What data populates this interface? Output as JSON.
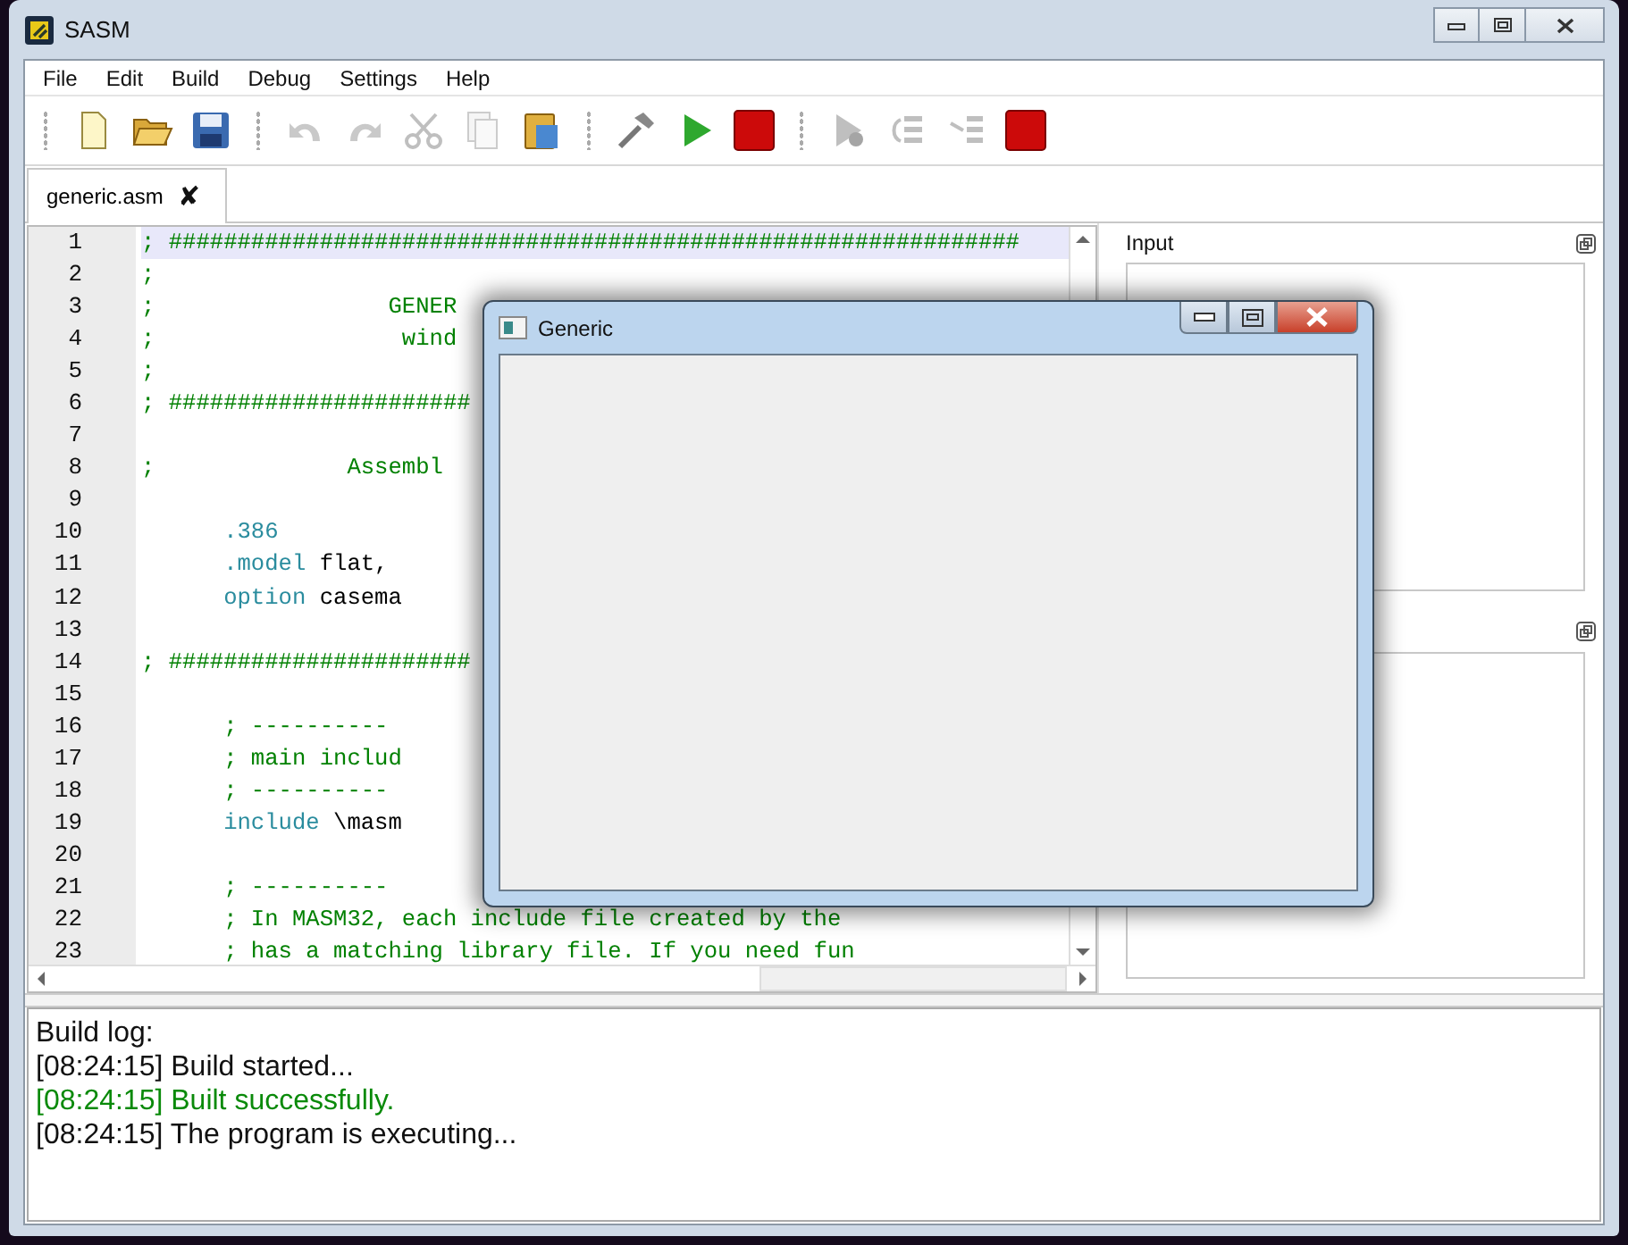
{
  "window": {
    "title": "SASM"
  },
  "menu": [
    "File",
    "Edit",
    "Build",
    "Debug",
    "Settings",
    "Help"
  ],
  "toolbar": [
    [
      {
        "kind": "new",
        "disabled": false
      },
      {
        "kind": "open",
        "disabled": false
      },
      {
        "kind": "save",
        "disabled": false
      }
    ],
    [
      {
        "kind": "undo",
        "disabled": true
      },
      {
        "kind": "redo",
        "disabled": true
      },
      {
        "kind": "cut",
        "disabled": true
      },
      {
        "kind": "copy",
        "disabled": true
      },
      {
        "kind": "paste",
        "disabled": false
      }
    ],
    [
      {
        "kind": "build",
        "disabled": false
      },
      {
        "kind": "run",
        "disabled": false
      },
      {
        "kind": "stop",
        "disabled": false
      }
    ],
    [
      {
        "kind": "debug",
        "disabled": true
      },
      {
        "kind": "step-over",
        "disabled": true
      },
      {
        "kind": "step-into",
        "disabled": true
      },
      {
        "kind": "stop",
        "disabled": false
      }
    ]
  ],
  "tabs": [
    {
      "label": "generic.asm",
      "close": "✘",
      "selected": true
    }
  ],
  "editor": {
    "lines": [
      {
        "number": "1",
        "highlighted": true,
        "segments": [
          {
            "kind": "comment",
            "text": "; ##############################################################"
          }
        ]
      },
      {
        "number": "2",
        "highlighted": false,
        "segments": [
          {
            "kind": "comment",
            "text": ";"
          }
        ]
      },
      {
        "number": "3",
        "highlighted": false,
        "segments": [
          {
            "kind": "comment",
            "text": ";                 GENER"
          }
        ]
      },
      {
        "number": "4",
        "highlighted": false,
        "segments": [
          {
            "kind": "comment",
            "text": ";                  wind"
          }
        ]
      },
      {
        "number": "5",
        "highlighted": false,
        "segments": [
          {
            "kind": "comment",
            "text": ";"
          }
        ]
      },
      {
        "number": "6",
        "highlighted": false,
        "segments": [
          {
            "kind": "comment",
            "text": "; ######################"
          }
        ]
      },
      {
        "number": "7",
        "highlighted": false
      },
      {
        "number": "8",
        "highlighted": false,
        "segments": [
          {
            "kind": "comment",
            "text": ";              Assembl"
          }
        ]
      },
      {
        "number": "9",
        "highlighted": false
      },
      {
        "number": "10",
        "highlighted": false,
        "segments": [
          {
            "kind": "directive",
            "text": "      .386"
          }
        ]
      },
      {
        "number": "11",
        "highlighted": false,
        "segments": [
          {
            "kind": "directive",
            "text": "      .model"
          },
          {
            "kind": "plain",
            "text": " flat,"
          }
        ]
      },
      {
        "number": "12",
        "highlighted": false,
        "segments": [
          {
            "kind": "directive",
            "text": "      option"
          },
          {
            "kind": "plain",
            "text": " casema"
          }
        ]
      },
      {
        "number": "13",
        "highlighted": false
      },
      {
        "number": "14",
        "highlighted": false,
        "segments": [
          {
            "kind": "comment",
            "text": "; ######################"
          }
        ]
      },
      {
        "number": "15",
        "highlighted": false
      },
      {
        "number": "16",
        "highlighted": false,
        "segments": [
          {
            "kind": "comment",
            "text": "      ; ----------"
          }
        ]
      },
      {
        "number": "17",
        "highlighted": false,
        "segments": [
          {
            "kind": "comment",
            "text": "      ; main includ"
          }
        ]
      },
      {
        "number": "18",
        "highlighted": false,
        "segments": [
          {
            "kind": "comment",
            "text": "      ; ----------"
          }
        ]
      },
      {
        "number": "19",
        "highlighted": false,
        "segments": [
          {
            "kind": "directive",
            "text": "      include"
          },
          {
            "kind": "plain",
            "text": " \\masm"
          }
        ]
      },
      {
        "number": "20",
        "highlighted": false
      },
      {
        "number": "21",
        "highlighted": false,
        "segments": [
          {
            "kind": "comment",
            "text": "      ; ----------"
          }
        ]
      },
      {
        "number": "22",
        "highlighted": false,
        "segments": [
          {
            "kind": "comment",
            "text": "      ; In MASM32, each include file created by the"
          }
        ]
      },
      {
        "number": "23",
        "highlighted": false,
        "segments": [
          {
            "kind": "comment",
            "text": "      ; has a matching library file. If you need fun"
          }
        ]
      }
    ]
  },
  "input_panel": {
    "title": "Input"
  },
  "build_log": [
    {
      "kind": "info",
      "text": "Build log:"
    },
    {
      "kind": "info",
      "text": "[08:24:15] Build started..."
    },
    {
      "kind": "success",
      "text": "[08:24:15] Built successfully."
    },
    {
      "kind": "info",
      "text": "[08:24:15] The program is executing..."
    }
  ],
  "program_window": {
    "title": "Generic"
  }
}
